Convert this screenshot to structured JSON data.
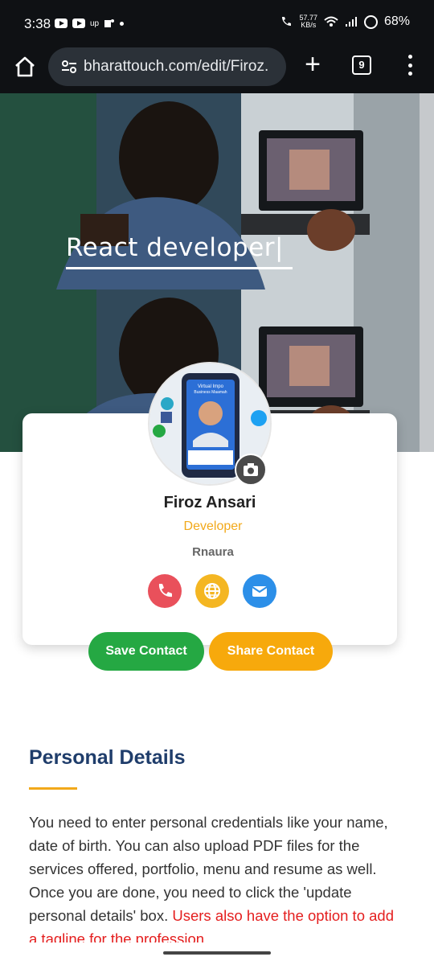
{
  "status": {
    "time": "3:38",
    "up_label": "up",
    "speed_top": "57.77",
    "speed_unit": "KB/s",
    "battery": "68%"
  },
  "browser": {
    "url": "bharattouch.com/edit/Firoz.",
    "tab_count": "9"
  },
  "hero": {
    "headline": "React developer|"
  },
  "profile": {
    "name": "Firoz Ansari",
    "role": "Developer",
    "company": "Rnaura",
    "avatar_card_lines": [
      "Virtual Impo",
      "Business Maamah"
    ]
  },
  "actions": {
    "save_label": "Save Contact",
    "share_label": "Share Contact"
  },
  "personal_details": {
    "title": "Personal Details",
    "body": "You need to enter personal credentials like your name, date of birth. You can also upload PDF files for the services offered, portfolio, menu and resume as well. Once you are done, you need to click the 'update personal details' box.",
    "body_highlight": "Users also have the option to add a tagline for the profession"
  },
  "colors": {
    "accent_orange": "#f7a90c",
    "save_green": "#25a843",
    "title_blue": "#1f3d6b",
    "highlight_red": "#e41e1e"
  }
}
